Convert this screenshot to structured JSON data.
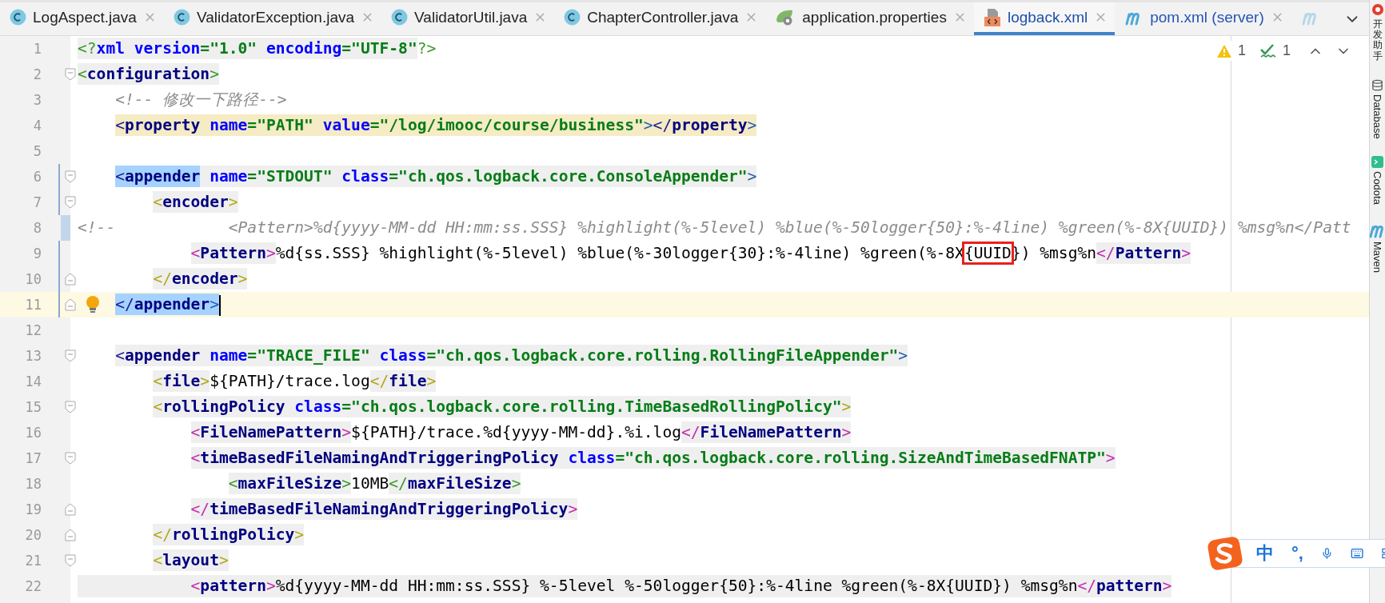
{
  "tabs": [
    {
      "label": "LogAspect.java",
      "kind": "class",
      "selected": false,
      "color": "#222222"
    },
    {
      "label": "ValidatorException.java",
      "kind": "class",
      "selected": false,
      "color": "#222222"
    },
    {
      "label": "ValidatorUtil.java",
      "kind": "class",
      "selected": false,
      "color": "#222222"
    },
    {
      "label": "ChapterController.java",
      "kind": "class",
      "selected": false,
      "color": "#222222"
    },
    {
      "label": "application.properties",
      "kind": "spring",
      "selected": false,
      "color": "#222222"
    },
    {
      "label": "logback.xml",
      "kind": "xml",
      "selected": true,
      "color": "#1f4fa8"
    },
    {
      "label": "pom.xml (server)",
      "kind": "maven",
      "selected": false,
      "color": "#2554b5"
    },
    {
      "kind": "maven",
      "selected": false
    }
  ],
  "inspections": [
    {
      "kind": "warning",
      "count": "1"
    },
    {
      "kind": "weak",
      "count": "1"
    }
  ],
  "lines": [
    {
      "number": "1",
      "parts": [
        {
          "text": "<?xml version=\"1.0\" encoding=\"UTF-8\"?>"
        }
      ]
    },
    {
      "number": "2",
      "fold_start": true,
      "parts": [
        {
          "text": "<configuration>"
        }
      ]
    },
    {
      "number": "3",
      "parts": [
        {
          "text": "    <!-- 修改一下路径-->"
        }
      ]
    },
    {
      "number": "4",
      "usage_highlight": true,
      "parts": [
        {
          "text": "    <property name=\"PATH\" value=\"/log/imooc/course/business\"></property>"
        }
      ]
    },
    {
      "number": "5"
    },
    {
      "number": "6",
      "fold_start": true,
      "changed": true,
      "match_highlight": true,
      "parts": [
        {
          "text": "    <appender name=\"STDOUT\" class=\"ch.qos.logback.core.ConsoleAppender\">"
        }
      ]
    },
    {
      "number": "7",
      "fold_start": true,
      "changed": true,
      "parts": [
        {
          "text": "        <encoder>"
        }
      ]
    },
    {
      "number": "8",
      "changed": true,
      "commented_out": true,
      "parts": [
        {
          "text": "<!--            <Pattern>%d{yyyy-MM-dd HH:mm:ss.SSS} %highlight(%-5level) %blue(%-50logger{50}:%-4line) %green(%-8X{UUID}) %msg%n</Patt"
        }
      ]
    },
    {
      "number": "9",
      "changed": true,
      "parts": [
        {
          "text": "            <Pattern>%d{ss.SSS} %highlight(%-5level) %blue(%-30logger{30}:%-4line) %green(%-8X",
          "boxed": false
        },
        {
          "text": "{UUID",
          "boxed": true
        },
        {
          "text": "}) %msg%n</Pattern>",
          "boxed": false
        }
      ]
    },
    {
      "number": "10",
      "fold_end": true,
      "changed": true,
      "parts": [
        {
          "text": "        </encoder>"
        }
      ]
    },
    {
      "number": "11",
      "fold_end": true,
      "changed": true,
      "current": true,
      "match_highlight": true,
      "parts": [
        {
          "text": "    </appender>"
        }
      ]
    },
    {
      "number": "12"
    },
    {
      "number": "13",
      "fold_start": true,
      "parts": [
        {
          "text": "    <appender name=\"TRACE_FILE\" class=\"ch.qos.logback.core.rolling.RollingFileAppender\">"
        }
      ]
    },
    {
      "number": "14",
      "parts": [
        {
          "text": "        <file>${PATH}/trace.log</file>"
        }
      ]
    },
    {
      "number": "15",
      "fold_start": true,
      "parts": [
        {
          "text": "        <rollingPolicy class=\"ch.qos.logback.core.rolling.TimeBasedRollingPolicy\">"
        }
      ]
    },
    {
      "number": "16",
      "parts": [
        {
          "text": "            <FileNamePattern>${PATH}/trace.%d{yyyy-MM-dd}.%i.log</FileNamePattern>"
        }
      ]
    },
    {
      "number": "17",
      "fold_start": true,
      "parts": [
        {
          "text": "            <timeBasedFileNamingAndTriggeringPolicy class=\"ch.qos.logback.core.rolling.SizeAndTimeBasedFNATP\">"
        }
      ]
    },
    {
      "number": "18",
      "parts": [
        {
          "text": "                <maxFileSize>10MB</maxFileSize>"
        }
      ]
    },
    {
      "number": "19",
      "fold_end": true,
      "parts": [
        {
          "text": "            </timeBasedFileNamingAndTriggeringPolicy>"
        }
      ]
    },
    {
      "number": "20",
      "fold_end": true,
      "parts": [
        {
          "text": "        </rollingPolicy>"
        }
      ]
    },
    {
      "number": "21",
      "fold_start": true,
      "parts": [
        {
          "text": "        <layout>"
        }
      ]
    },
    {
      "number": "22",
      "shaded": true,
      "parts": [
        {
          "text": "            <pattern>%d{yyyy-MM-dd HH:mm:ss.SSS} %-5level %-50logger{50}:%-4line %green(%-8X{UUID}) %msg%n</pattern>"
        }
      ]
    }
  ],
  "tool_windows": [
    {
      "label": "开发助手",
      "kind": "helper"
    },
    {
      "label": "Database",
      "kind": "database"
    },
    {
      "label": "Codota",
      "kind": "codota"
    },
    {
      "label": "Maven",
      "kind": "maven"
    }
  ],
  "ime_bar": {
    "mode": "中",
    "punctuation": "°,"
  }
}
